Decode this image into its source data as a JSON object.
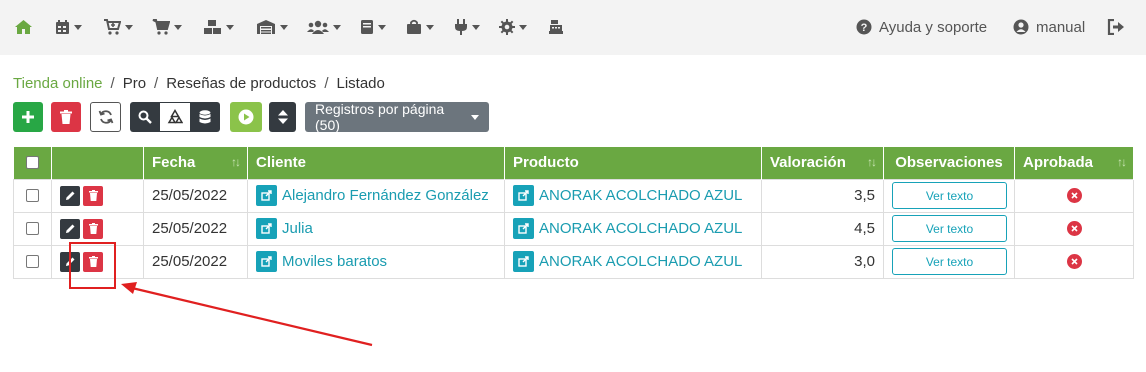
{
  "navbar": {
    "help_label": "Ayuda y soporte",
    "user_label": "manual",
    "menus": [
      "home-icon",
      "calendar-icon",
      "cart-plus-icon",
      "cart-icon",
      "boxes-icon",
      "warehouse-icon",
      "users-icon",
      "book-icon",
      "shopping-bag-icon",
      "plug-icon",
      "gear-icon",
      "cash-register-icon"
    ]
  },
  "breadcrumb": {
    "items": [
      "Tienda online",
      "Pro",
      "Reseñas de productos",
      "Listado"
    ]
  },
  "toolbar": {
    "per_page_label": "Registros por página (50)"
  },
  "colors": {
    "brand_green": "#6aa842",
    "danger": "#dc3545",
    "info": "#17a2b8",
    "dark": "#343a40"
  },
  "table": {
    "headers": [
      "Fecha",
      "Cliente",
      "Producto",
      "Valoración",
      "Observaciones",
      "Aprobada"
    ],
    "rows": [
      {
        "fecha": "25/05/2022",
        "cliente": "Alejandro Fernández González",
        "producto": "ANORAK ACOLCHADO AZUL",
        "valoracion": "3,5",
        "observaciones": "Ver texto"
      },
      {
        "fecha": "25/05/2022",
        "cliente": "Julia",
        "producto": "ANORAK ACOLCHADO AZUL",
        "valoracion": "4,5",
        "observaciones": "Ver texto"
      },
      {
        "fecha": "25/05/2022",
        "cliente": "Moviles baratos",
        "producto": "ANORAK ACOLCHADO AZUL",
        "valoracion": "3,0",
        "observaciones": "Ver texto"
      }
    ]
  }
}
